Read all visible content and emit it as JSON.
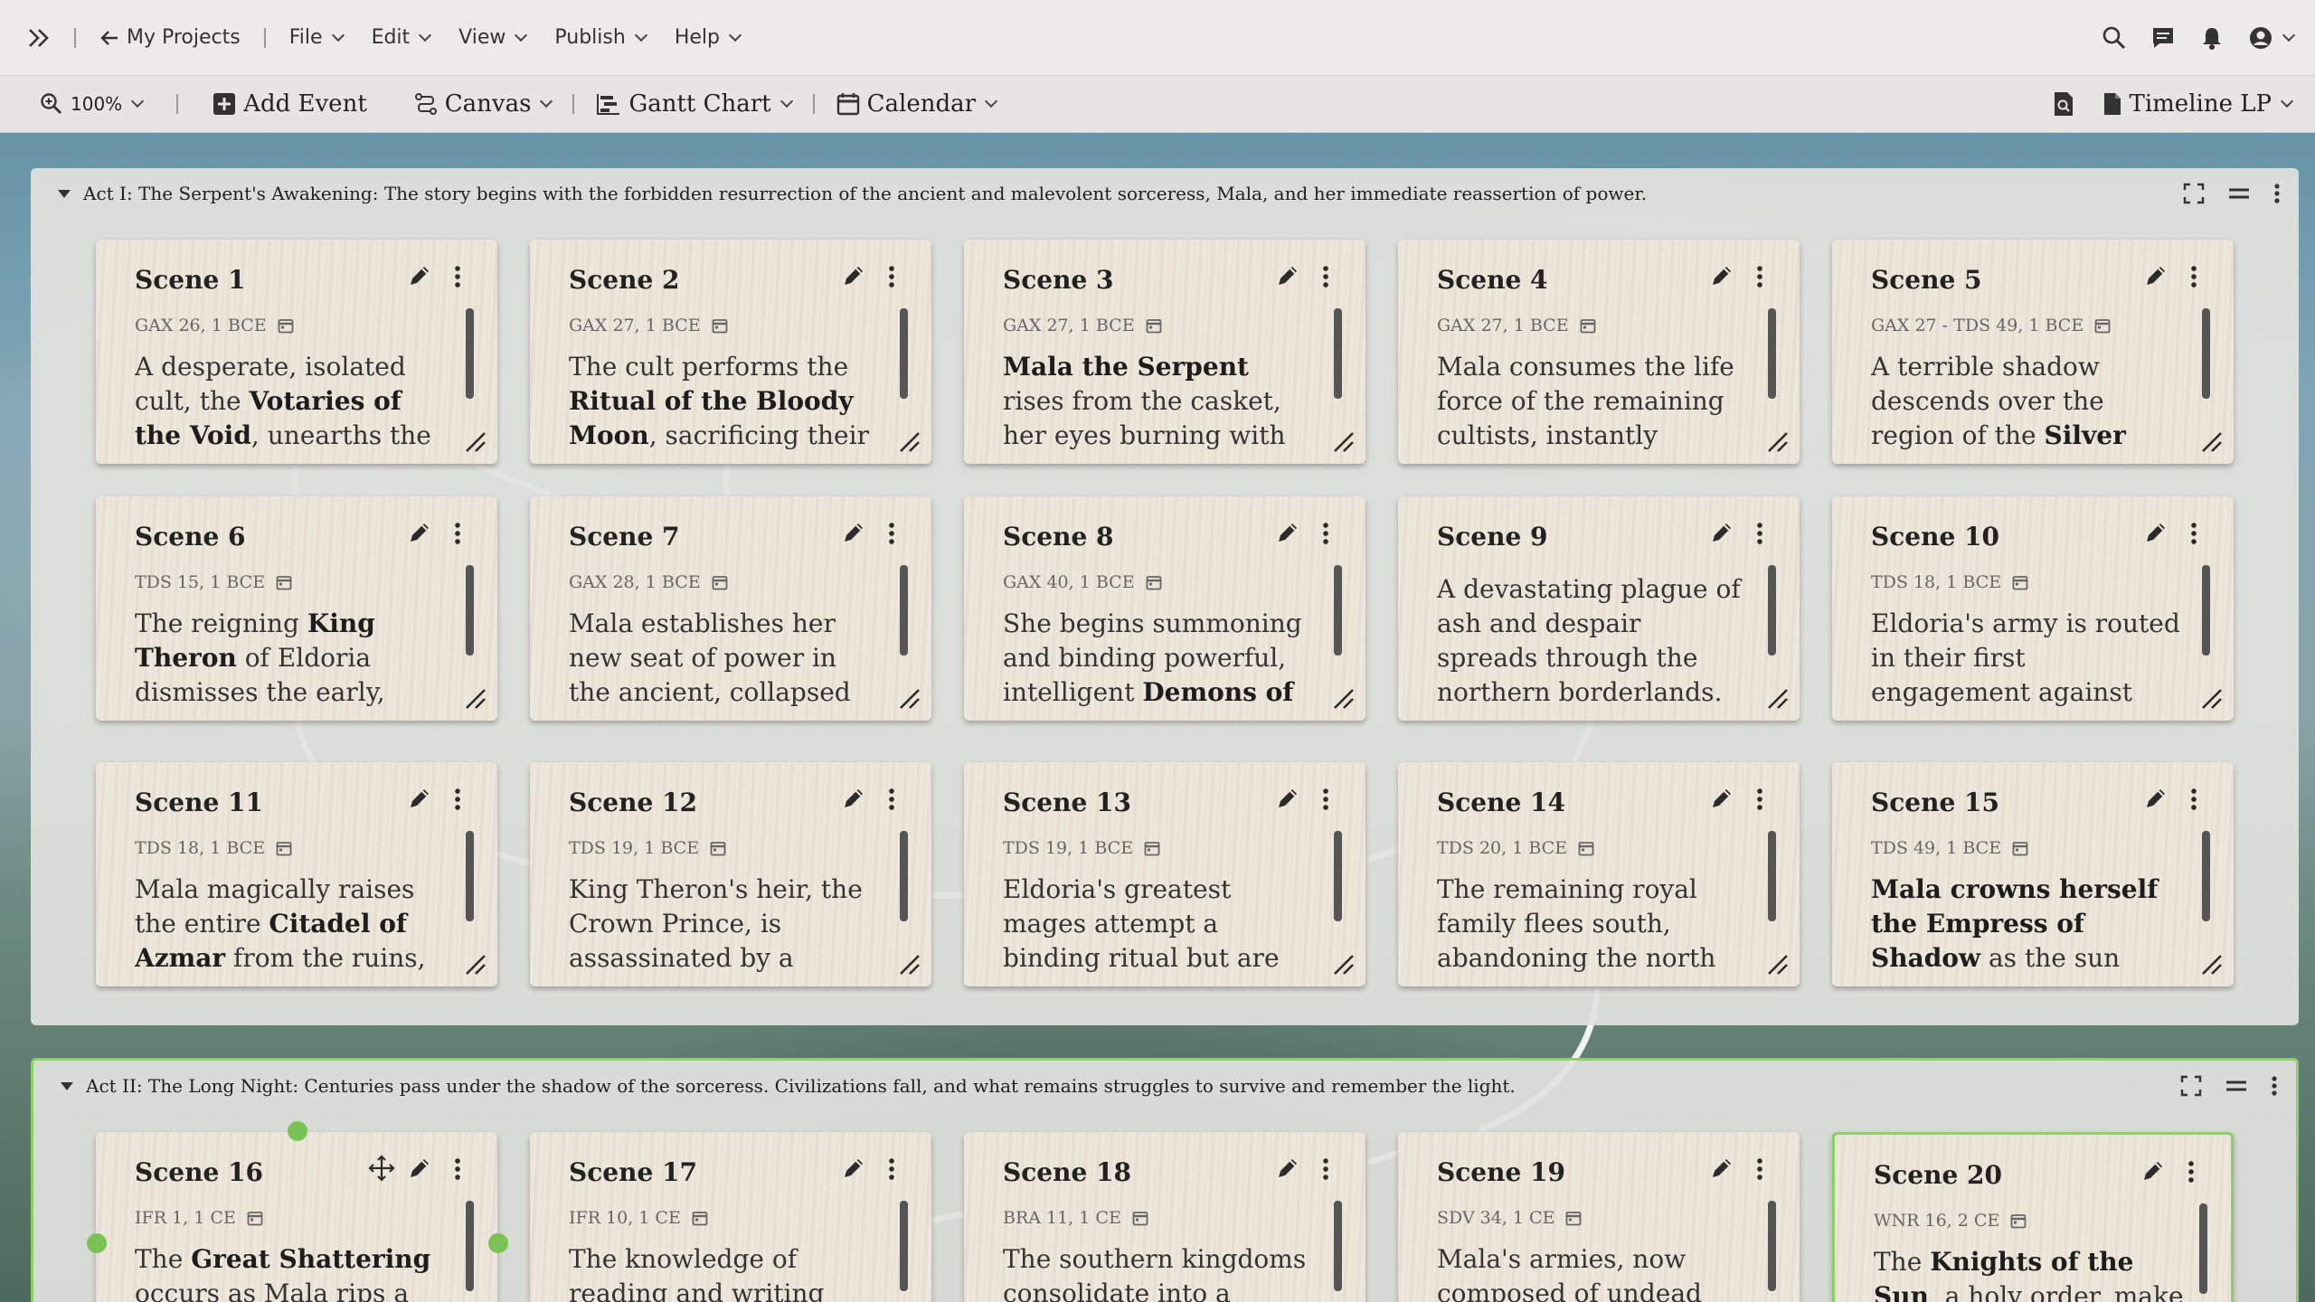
{
  "menubar": {
    "back_label": "My Projects",
    "menus": [
      "File",
      "Edit",
      "View",
      "Publish",
      "Help"
    ]
  },
  "toolbar": {
    "zoom": "100%",
    "add_event": "Add Event",
    "canvas": "Canvas",
    "gantt": "Gantt Chart",
    "calendar": "Calendar",
    "timeline": "Timeline LP"
  },
  "acts": [
    {
      "title": "Act I: The Serpent's Awakening: The story begins with the forbidden resurrection of the ancient and malevolent sorceress, Mala, and her immediate reassertion of power.",
      "scenes": [
        {
          "title": "Scene 1",
          "date": "GAX 26, 1 BCE",
          "desc_html": "A desperate, isolated cult, the <b>Votaries of the Void</b>, unearths the Obsidian"
        },
        {
          "title": "Scene 2",
          "date": "GAX 27, 1 BCE",
          "desc_html": "The cult performs the <b>Ritual of the Bloody Moon</b>, sacrificing their own high"
        },
        {
          "title": "Scene 3",
          "date": "GAX 27, 1 BCE",
          "desc_html": "<b>Mala the Serpent</b> rises from the casket, her eyes burning with an emerald,"
        },
        {
          "title": "Scene 4",
          "date": "GAX 27, 1 BCE",
          "desc_html": "Mala consumes the life force of the remaining cultists, instantly"
        },
        {
          "title": "Scene 5",
          "date": "GAX 27 - TDS 49, 1 BCE",
          "desc_html": "A terrible shadow descends over the region of the <b>Silver Peaks</b>,"
        },
        {
          "title": "Scene 6",
          "date": "TDS 15, 1 BCE",
          "desc_html": "The reigning <b>King Theron</b> of Eldoria dismisses the early, vague reports of"
        },
        {
          "title": "Scene 7",
          "date": "GAX 28, 1 BCE",
          "desc_html": "Mala establishes her new seat of power in the ancient, collapsed volcano"
        },
        {
          "title": "Scene 8",
          "date": "GAX 40, 1 BCE",
          "desc_html": "She begins summoning and binding powerful, intelligent <b>Demons of the</b>"
        },
        {
          "title": "Scene 9",
          "date": "",
          "desc_html": "A devastating plague of ash and despair spreads through the northern borderlands."
        },
        {
          "title": "Scene 10",
          "date": "TDS 18, 1 BCE",
          "desc_html": "Eldoria's army is routed in their first engagement against Mala's growing"
        },
        {
          "title": "Scene 11",
          "date": "TDS 18, 1 BCE",
          "desc_html": "Mala magically raises the entire <b>Citadel of Azmar</b> from the ruins, a"
        },
        {
          "title": "Scene 12",
          "date": "TDS 19, 1 BCE",
          "desc_html": "King Theron's heir, the Crown Prince, is assassinated by a Shade"
        },
        {
          "title": "Scene 13",
          "date": "TDS 19, 1 BCE",
          "desc_html": "Eldoria's greatest mages attempt a binding ritual but are all instantly"
        },
        {
          "title": "Scene 14",
          "date": "TDS 20, 1 BCE",
          "desc_html": "The remaining royal family flees south, abandoning the north to"
        },
        {
          "title": "Scene 15",
          "date": "TDS 49, 1 BCE",
          "desc_html": "<b>Mala crowns herself the Empress of Shadow</b> as the sun disappears from"
        }
      ]
    },
    {
      "title": "Act II: The Long Night: Centuries pass under the shadow of the sorceress. Civilizations fall, and what remains struggles to survive and remember the light.",
      "scenes": [
        {
          "title": "Scene 16",
          "date": "IFR 1, 1 CE",
          "desc_html": "The <b>Great Shattering</b> occurs as Mala rips a"
        },
        {
          "title": "Scene 17",
          "date": "IFR 10, 1 CE",
          "desc_html": "The knowledge of reading and writing nearly"
        },
        {
          "title": "Scene 18",
          "date": "BRA 11, 1 CE",
          "desc_html": "The southern kingdoms consolidate into a"
        },
        {
          "title": "Scene 19",
          "date": "SDV 34, 1 CE",
          "desc_html": "Mala's armies, now composed of undead"
        },
        {
          "title": "Scene 20",
          "date": "WNR 16, 2 CE",
          "desc_html": "The <b>Knights of the Sun</b>, a holy order, make a final,"
        }
      ]
    }
  ]
}
